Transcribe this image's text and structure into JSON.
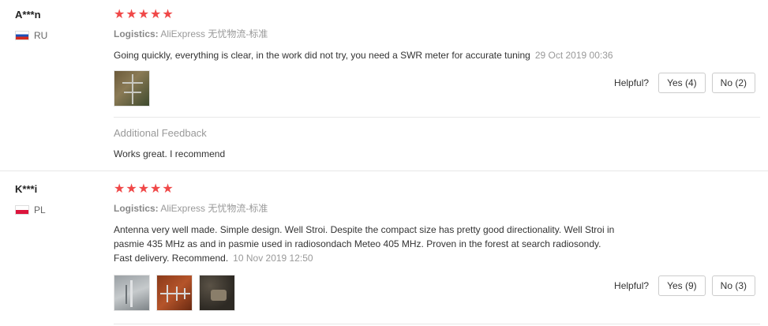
{
  "reviews": [
    {
      "username": "A***n",
      "country": "RU",
      "stars": "★★★★★",
      "logistics_label": "Logistics:",
      "logistics_value": "AliExpress 无忧物流-标准",
      "content": "Going quickly, everything is clear, in the work did not try, you need a SWR meter for accurate tuning",
      "date": "29 Oct 2019 00:36",
      "helpful_label": "Helpful?",
      "yes_label": "Yes (4)",
      "no_label": "No (2)",
      "additional_feedback_title": "Additional Feedback",
      "additional_feedback_text": "Works great. I recommend"
    },
    {
      "username": "K***i",
      "country": "PL",
      "stars": "★★★★★",
      "logistics_label": "Logistics:",
      "logistics_value": "AliExpress 无忧物流-标准",
      "content_lines": [
        "Antenna very well made. Simple design. Well Stroi. Despite the compact size has pretty good directionality. Well Stroi in",
        "pasmie 435 MHz as and in pasmie used in radiosondach Meteo 405 MHz. Proven in the forest at search radiosondy.",
        "Fast delivery. Recommend."
      ],
      "date": "10 Nov 2019 12:50",
      "helpful_label": "Helpful?",
      "yes_label": "Yes (9)",
      "no_label": "No (3)"
    }
  ],
  "colors": {
    "star": "#f04848",
    "meta_text": "#999999",
    "divider": "#e8e8e8"
  }
}
